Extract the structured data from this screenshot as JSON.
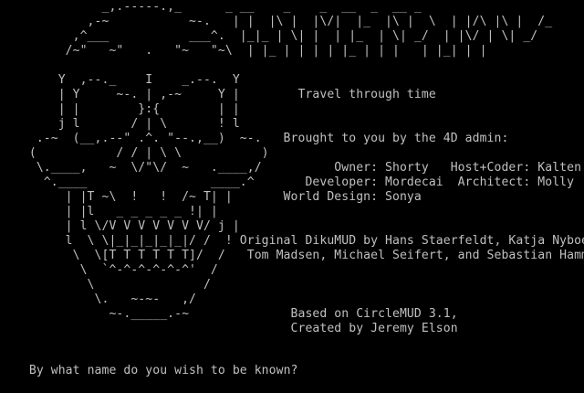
{
  "colors": {
    "background": "#000000",
    "text": "#c0c0c0"
  },
  "screen_lines": [
    "              _,.-----.,_      _ __    _    _  __  _  __ _ ",
    "            ,-~           ~-.   | |  |\\ |  |\\/|  |_  |\\ |  \\  | |/\\ |\\ |  /_",
    "          ,^___           ___^.  |_|_ | \\| |  | |_  | \\| _/  | |\\/ | \\| _/",
    "         /~\"   ~\"   .   \"~   \"~\\  | |_ | | | | |_ | | |   | |_| | | ",
    "        Y  ,--._    I    _.--.  Y",
    "        | Y     ~-. | ,-~     Y |        Travel through time",
    "        | |        }:{        | |",
    "        j l       / | \\       ! l",
    "     .-~  (__,.--\" .^. \"--.,__)  ~-.   Brought to you by the 4D admin:",
    "    (           / / | \\ \\           )",
    "     \\.____,   ~  \\/\"\\/  ~   .____,/          Owner: Shorty   Host+Coder: Kalten",
    "      ^.____                 ____.^       Developer: Mordecai  Architect: Molly",
    "         | |T ~\\  !   !  /~ T| |       World Design: Sonya",
    "         | |l   _ _ _ _ _ !| |",
    "         | l \\/V V V V V V V/ j |",
    "         l  \\ \\|_|_|_|_|_|/ /  ! Original DikuMUD by Hans Staerfeldt, Katja Nyboe,",
    "          \\  \\[T T T T T T]/  /   Tom Madsen, Michael Seifert, and Sebastian Hammer",
    "           \\  `^-^-^-^-^-^'  /",
    "            \\               /",
    "             \\.   ~-~-   ,/",
    "               ~-._____.-~              Based on CircleMUD 3.1,",
    "                                        Created by Jeremy Elson",
    ""
  ],
  "prompt": {
    "label": "By what name do you wish to be known?",
    "value": ""
  }
}
